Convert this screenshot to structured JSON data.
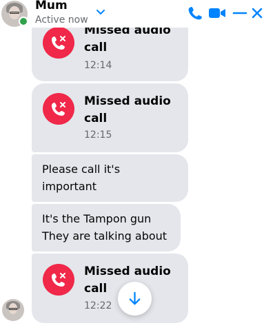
{
  "header": {
    "name": "Mum",
    "status": "Active now",
    "icons": [
      "chevron-down-icon",
      "phone-icon",
      "video-camera-icon",
      "minimize-icon",
      "close-icon"
    ]
  },
  "messages": [
    {
      "type": "missed_call",
      "title": "Missed audio call",
      "time": "12:14"
    },
    {
      "type": "missed_call",
      "title": "Missed audio call",
      "time": "12:15"
    },
    {
      "type": "text",
      "text": "Please call it's important"
    },
    {
      "type": "text",
      "text": "It's the Tampon gun They are talking about"
    },
    {
      "type": "missed_call",
      "title": "Missed audio call",
      "time": "12:22"
    }
  ],
  "colors": {
    "accent": "#0084ff",
    "missed_call": "#f02849",
    "bubble": "#e4e6eb",
    "online": "#31a24c"
  }
}
